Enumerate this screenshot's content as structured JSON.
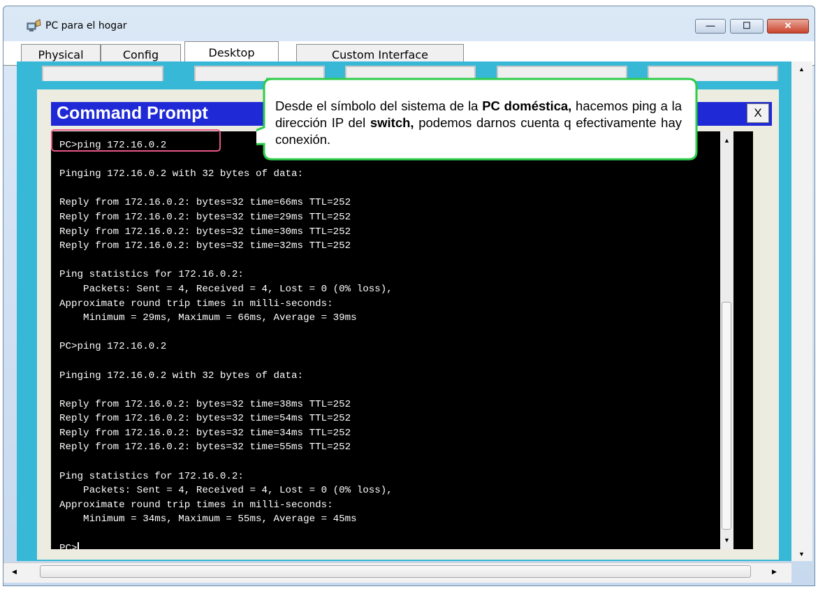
{
  "window": {
    "title": "PC para el hogar",
    "controls": {
      "minimize": "—",
      "maximize": "☐",
      "close": "✕"
    }
  },
  "tabs": [
    {
      "label": "Physical",
      "active": false
    },
    {
      "label": "Config",
      "active": false
    },
    {
      "label": "Desktop",
      "active": true
    },
    {
      "label": "Custom Interface",
      "active": false
    }
  ],
  "command_prompt": {
    "title": "Command Prompt",
    "close_label": "X",
    "lines": [
      "PC>ping 172.16.0.2",
      "",
      "Pinging 172.16.0.2 with 32 bytes of data:",
      "",
      "Reply from 172.16.0.2: bytes=32 time=66ms TTL=252",
      "Reply from 172.16.0.2: bytes=32 time=29ms TTL=252",
      "Reply from 172.16.0.2: bytes=32 time=30ms TTL=252",
      "Reply from 172.16.0.2: bytes=32 time=32ms TTL=252",
      "",
      "Ping statistics for 172.16.0.2:",
      "    Packets: Sent = 4, Received = 4, Lost = 0 (0% loss),",
      "Approximate round trip times in milli-seconds:",
      "    Minimum = 29ms, Maximum = 66ms, Average = 39ms",
      "",
      "PC>ping 172.16.0.2",
      "",
      "Pinging 172.16.0.2 with 32 bytes of data:",
      "",
      "Reply from 172.16.0.2: bytes=32 time=38ms TTL=252",
      "Reply from 172.16.0.2: bytes=32 time=54ms TTL=252",
      "Reply from 172.16.0.2: bytes=32 time=34ms TTL=252",
      "Reply from 172.16.0.2: bytes=32 time=55ms TTL=252",
      "",
      "Ping statistics for 172.16.0.2:",
      "    Packets: Sent = 4, Received = 4, Lost = 0 (0% loss),",
      "Approximate round trip times in milli-seconds:",
      "    Minimum = 34ms, Maximum = 55ms, Average = 45ms",
      "",
      "PC>"
    ]
  },
  "callout": {
    "segments": [
      {
        "text": "Desde el símbolo del sistema de la ",
        "bold": false
      },
      {
        "text": "PC doméstica,",
        "bold": true
      },
      {
        "text": " hacemos ping a la dirección IP del ",
        "bold": false
      },
      {
        "text": "switch,",
        "bold": true
      },
      {
        "text": " podemos darnos cuenta q efectivamente hay conexión.",
        "bold": false
      }
    ]
  },
  "colors": {
    "desktop_bg": "#37b8d6",
    "prompt_title_bg": "#1f29d6",
    "console_bg": "#000000",
    "callout_border": "#2ecc4a",
    "highlight_border": "#e8578a"
  }
}
